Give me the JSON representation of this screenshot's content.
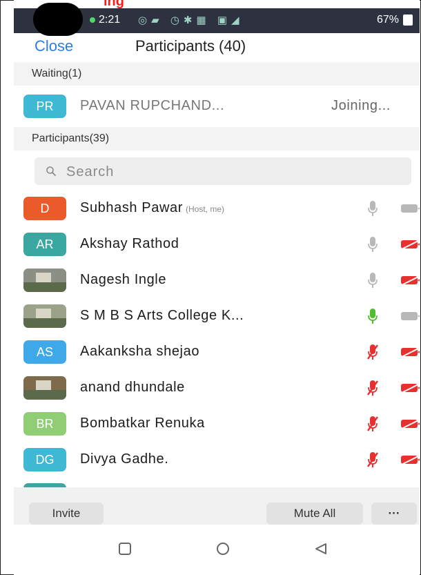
{
  "annotation_text": "ing",
  "status_bar": {
    "time": "2:21",
    "battery": "67%"
  },
  "header": {
    "close_label": "Close",
    "title": "Participants (40)"
  },
  "waiting": {
    "section_label": "Waiting(1)",
    "items": [
      {
        "initials": "PR",
        "name": "PAVAN RUPCHAND...",
        "status": "Joining...",
        "color": "#3fb8d4"
      }
    ]
  },
  "participants": {
    "section_label": "Participants(39)",
    "search_placeholder": "Search",
    "items": [
      {
        "initials": "D",
        "name": "Subhash Pawar",
        "tag": "(Host, me)",
        "color": "#ea5a2a",
        "mic": "off-gray",
        "video": "off-gray"
      },
      {
        "initials": "AR",
        "name": "Akshay Rathod",
        "tag": "",
        "color": "#3aa8a0",
        "mic": "off-gray",
        "video": "muted-red"
      },
      {
        "initials": "",
        "name": "Nagesh Ingle",
        "tag": "",
        "color": "#8b8f84",
        "mic": "off-gray",
        "video": "muted-red",
        "photo": true
      },
      {
        "initials": "",
        "name": "S M B S Arts College K...",
        "tag": "",
        "color": "#9aa38a",
        "mic": "active-green",
        "video": "off-gray",
        "photo": true
      },
      {
        "initials": "AS",
        "name": "Aakanksha shejao",
        "tag": "",
        "color": "#3fa8e8",
        "mic": "muted-red",
        "video": "muted-red"
      },
      {
        "initials": "",
        "name": "anand dhundale",
        "tag": "",
        "color": "#7d6b4c",
        "mic": "muted-red",
        "video": "muted-red",
        "photo": true
      },
      {
        "initials": "BR",
        "name": "Bombatkar Renuka",
        "tag": "",
        "color": "#8fce74",
        "mic": "muted-red",
        "video": "muted-red"
      },
      {
        "initials": "DG",
        "name": "Divya Gadhe.",
        "tag": "",
        "color": "#3fb8d4",
        "mic": "muted-red",
        "video": "muted-red"
      }
    ]
  },
  "footer": {
    "invite_label": "Invite",
    "mute_all_label": "Mute All",
    "more_label": "···"
  },
  "icons": {
    "mic_gray": "#b8b8b8",
    "mic_green": "#4cbf2e",
    "muted_red": "#e8302f",
    "accent": "#2e7ce6"
  }
}
